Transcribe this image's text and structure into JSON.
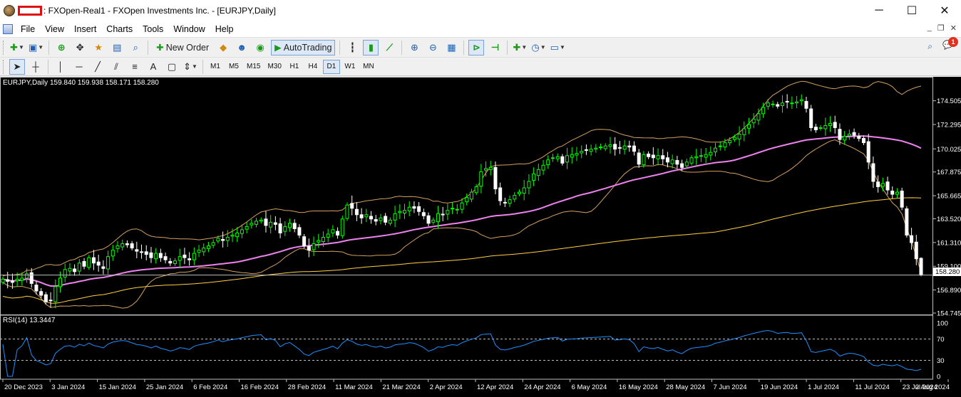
{
  "window": {
    "title": ": FXOpen-Real1 - FXOpen Investments Inc. - [EURJPY,Daily]",
    "controls": [
      "─",
      "☐",
      "✕"
    ]
  },
  "menu": {
    "items": [
      "File",
      "View",
      "Insert",
      "Charts",
      "Tools",
      "Window",
      "Help"
    ],
    "mdi_controls": [
      "_",
      "❐",
      "✕"
    ]
  },
  "toolbar": {
    "new_order_label": "New Order",
    "autotrading_label": "AutoTrading",
    "notification_count": "1"
  },
  "timeframes": {
    "items": [
      "M1",
      "M5",
      "M15",
      "M30",
      "H1",
      "H4",
      "D1",
      "W1",
      "MN"
    ],
    "active": "D1"
  },
  "chart": {
    "header": "EURJPY,Daily  159.840 159.938 158.171 158.280",
    "current_price_tag": "158.280",
    "rsi_label": "RSI(14) 13.3447",
    "colors": {
      "background": "#000000",
      "bull_candle": "#00ff00",
      "bear_candle": "#ffffff",
      "bollinger": "#d4a060",
      "ma_fast": "#ee82ee",
      "ma_slow": "#ffd040",
      "rsi": "#1e90ff"
    }
  },
  "chart_data": {
    "type": "candlestick",
    "symbol": "EURJPY",
    "timeframe": "Daily",
    "price_ticks": [
      "174.505",
      "172.295",
      "170.025",
      "167.875",
      "165.665",
      "163.520",
      "161.310",
      "159.100",
      "156.890",
      "154.745"
    ],
    "price_tick_values": [
      174.505,
      172.295,
      170.025,
      167.875,
      165.665,
      163.52,
      161.31,
      159.1,
      156.89,
      154.745
    ],
    "ylim": [
      154.745,
      176.6
    ],
    "date_ticks": [
      "20 Dec 2023",
      "3 Jan 2024",
      "15 Jan 2024",
      "25 Jan 2024",
      "6 Feb 2024",
      "16 Feb 2024",
      "28 Feb 2024",
      "11 Mar 2024",
      "21 Mar 2024",
      "2 Apr 2024",
      "12 Apr 2024",
      "24 Apr 2024",
      "6 May 2024",
      "16 May 2024",
      "28 May 2024",
      "7 Jun 2024",
      "19 Jun 2024",
      "1 Jul 2024",
      "11 Jul 2024",
      "23 Jul 2024",
      "2 Aug 2024"
    ],
    "close": [
      157.9,
      157.7,
      157.6,
      157.9,
      158.0,
      158.4,
      157.5,
      156.8,
      156.4,
      155.8,
      155.9,
      157.2,
      158.0,
      158.8,
      158.9,
      158.6,
      159.4,
      159.1,
      159.9,
      159.4,
      159.2,
      158.9,
      160.0,
      160.6,
      161.0,
      161.2,
      161.1,
      160.8,
      160.5,
      160.4,
      160.2,
      159.9,
      160.3,
      159.9,
      159.7,
      159.4,
      159.6,
      160.0,
      159.9,
      159.7,
      160.3,
      160.6,
      160.8,
      161.0,
      161.3,
      161.7,
      161.5,
      161.8,
      162.0,
      162.2,
      162.5,
      162.8,
      163.1,
      163.3,
      163.4,
      162.9,
      163.2,
      163.0,
      162.2,
      162.8,
      163.1,
      162.6,
      162.0,
      161.0,
      160.6,
      161.2,
      161.5,
      161.8,
      162.1,
      162.5,
      162.0,
      163.5,
      164.8,
      164.5,
      163.9,
      163.6,
      163.9,
      163.5,
      163.3,
      163.6,
      163.2,
      163.4,
      164.0,
      164.2,
      164.3,
      164.6,
      164.5,
      164.2,
      163.8,
      163.1,
      163.4,
      164.0,
      163.9,
      164.3,
      164.5,
      164.4,
      165.0,
      165.5,
      166.0,
      166.5,
      167.9,
      168.2,
      168.3,
      166.3,
      165.2,
      165.0,
      165.3,
      165.7,
      166.0,
      166.4,
      167.0,
      167.7,
      168.1,
      168.5,
      169.0,
      169.2,
      169.3,
      168.7,
      169.4,
      169.5,
      169.6,
      169.8,
      169.9,
      170.0,
      170.1,
      170.2,
      170.3,
      170.4,
      170.0,
      170.1,
      170.3,
      170.2,
      169.8,
      168.6,
      169.5,
      169.3,
      169.2,
      169.4,
      169.1,
      168.8,
      169.0,
      168.6,
      168.3,
      168.8,
      169.2,
      169.3,
      169.4,
      169.5,
      169.7,
      170.1,
      170.3,
      170.6,
      170.8,
      171.1,
      171.4,
      171.9,
      172.3,
      172.8,
      173.3,
      173.9,
      174.3,
      174.2,
      174.0,
      174.3,
      174.4,
      174.3,
      174.4,
      174.6,
      173.8,
      172.0,
      171.8,
      172.0,
      172.2,
      172.4,
      172.0,
      170.9,
      171.2,
      171.4,
      171.3,
      171.0,
      170.6,
      168.8,
      167.0,
      166.5,
      166.8,
      166.2,
      165.8,
      166.0,
      164.6,
      162.0,
      161.3,
      159.8,
      158.28
    ],
    "series": [
      {
        "name": "RSI(14)",
        "last_value": 13.3447,
        "levels": [
          70,
          30
        ],
        "ylim": [
          0,
          100
        ],
        "ticks": [
          "100",
          "70",
          "30",
          "0"
        ]
      }
    ]
  }
}
